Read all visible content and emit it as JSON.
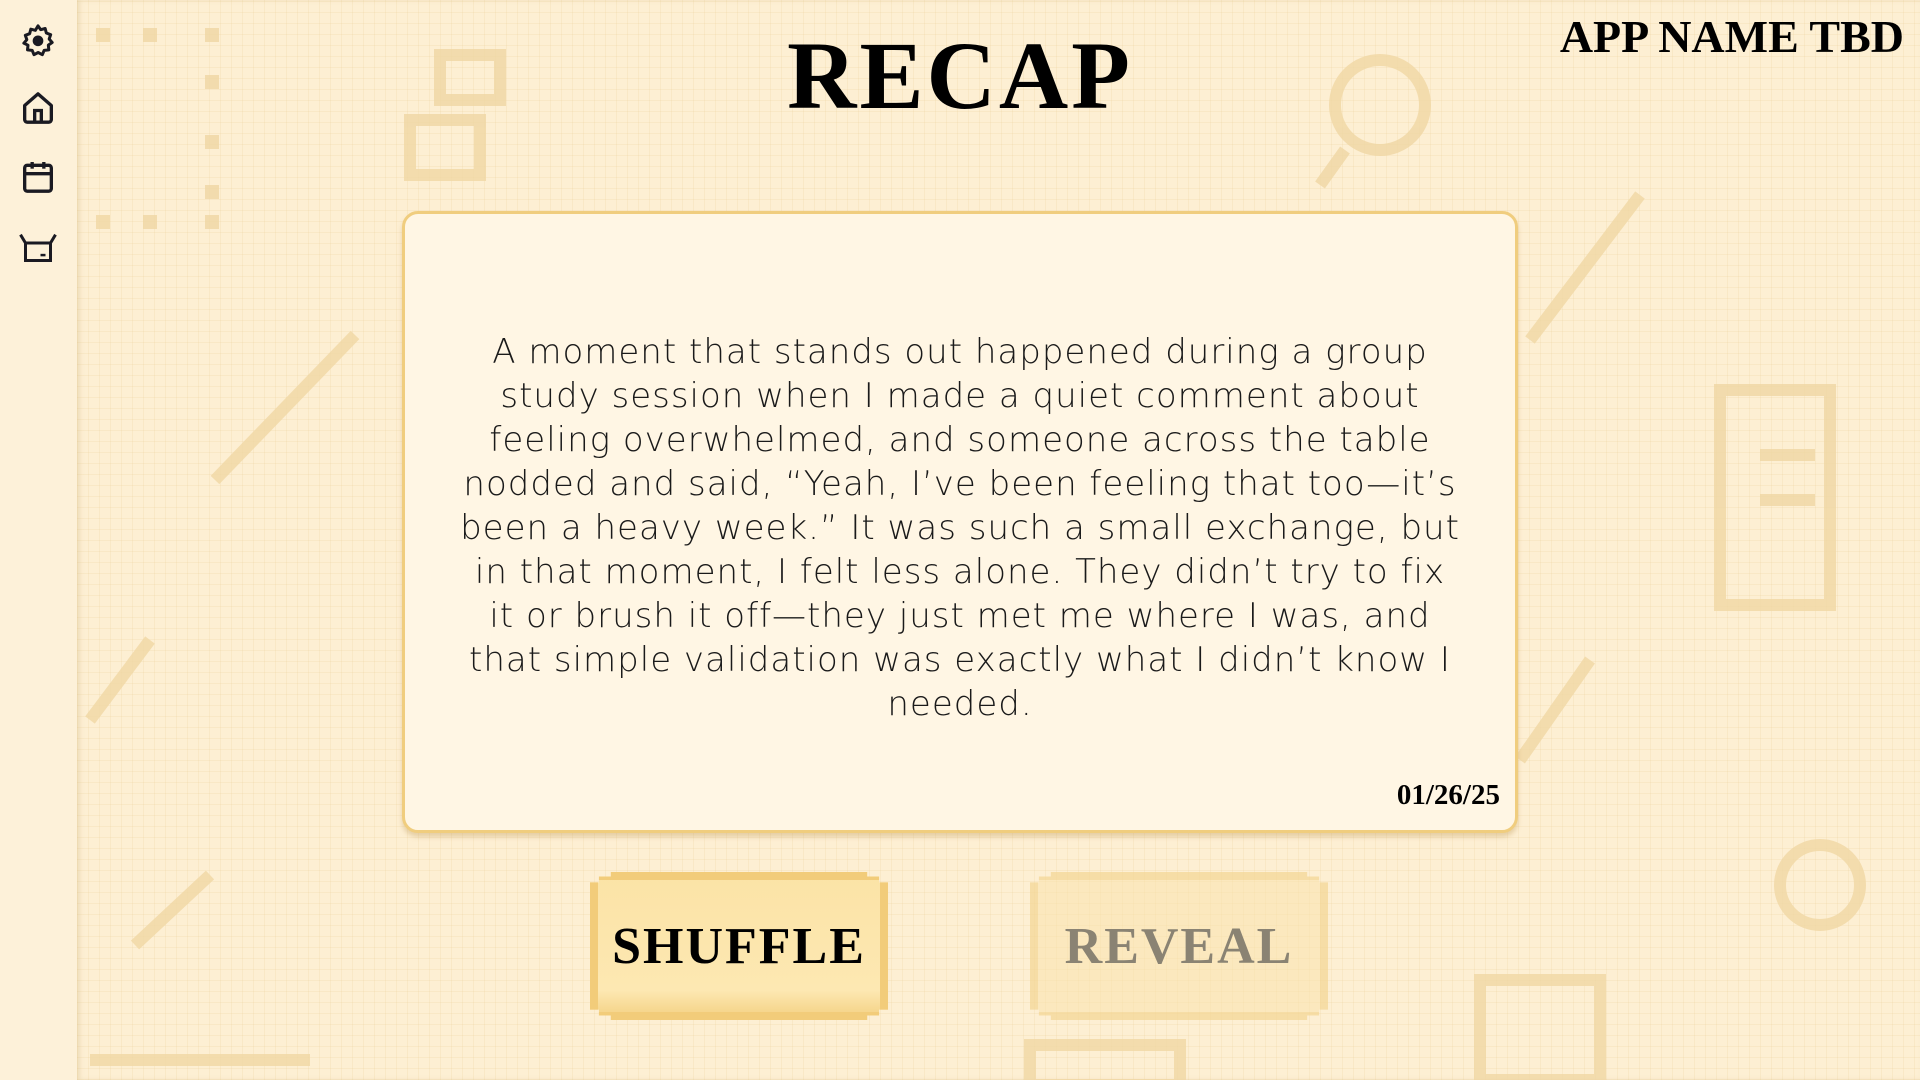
{
  "app_name": "APP NAME TBD",
  "page_title": "RECAP",
  "sidebar": {
    "items": [
      {
        "icon": "gear-icon",
        "label": "Settings"
      },
      {
        "icon": "home-icon",
        "label": "Home"
      },
      {
        "icon": "calendar-icon",
        "label": "Calendar"
      },
      {
        "icon": "box-icon",
        "label": "Box"
      }
    ]
  },
  "card": {
    "text": "A moment that stands out happened during a group study session when I made a quiet comment about feeling overwhelmed, and someone across the table nodded and said, “Yeah, I’ve been feeling that too—it’s been a heavy week.” It was such a small exchange, but in that moment, I felt less alone. They didn’t try to fix it or brush it off—they just met me where I was, and that simple validation was exactly what I didn’t know I needed.",
    "date": "01/26/25"
  },
  "buttons": {
    "shuffle": "SHUFFLE",
    "reveal": "REVEAL"
  },
  "colors": {
    "background": "#fdefd3",
    "card_border": "#f0cd7e",
    "button": "#fde8b2"
  }
}
